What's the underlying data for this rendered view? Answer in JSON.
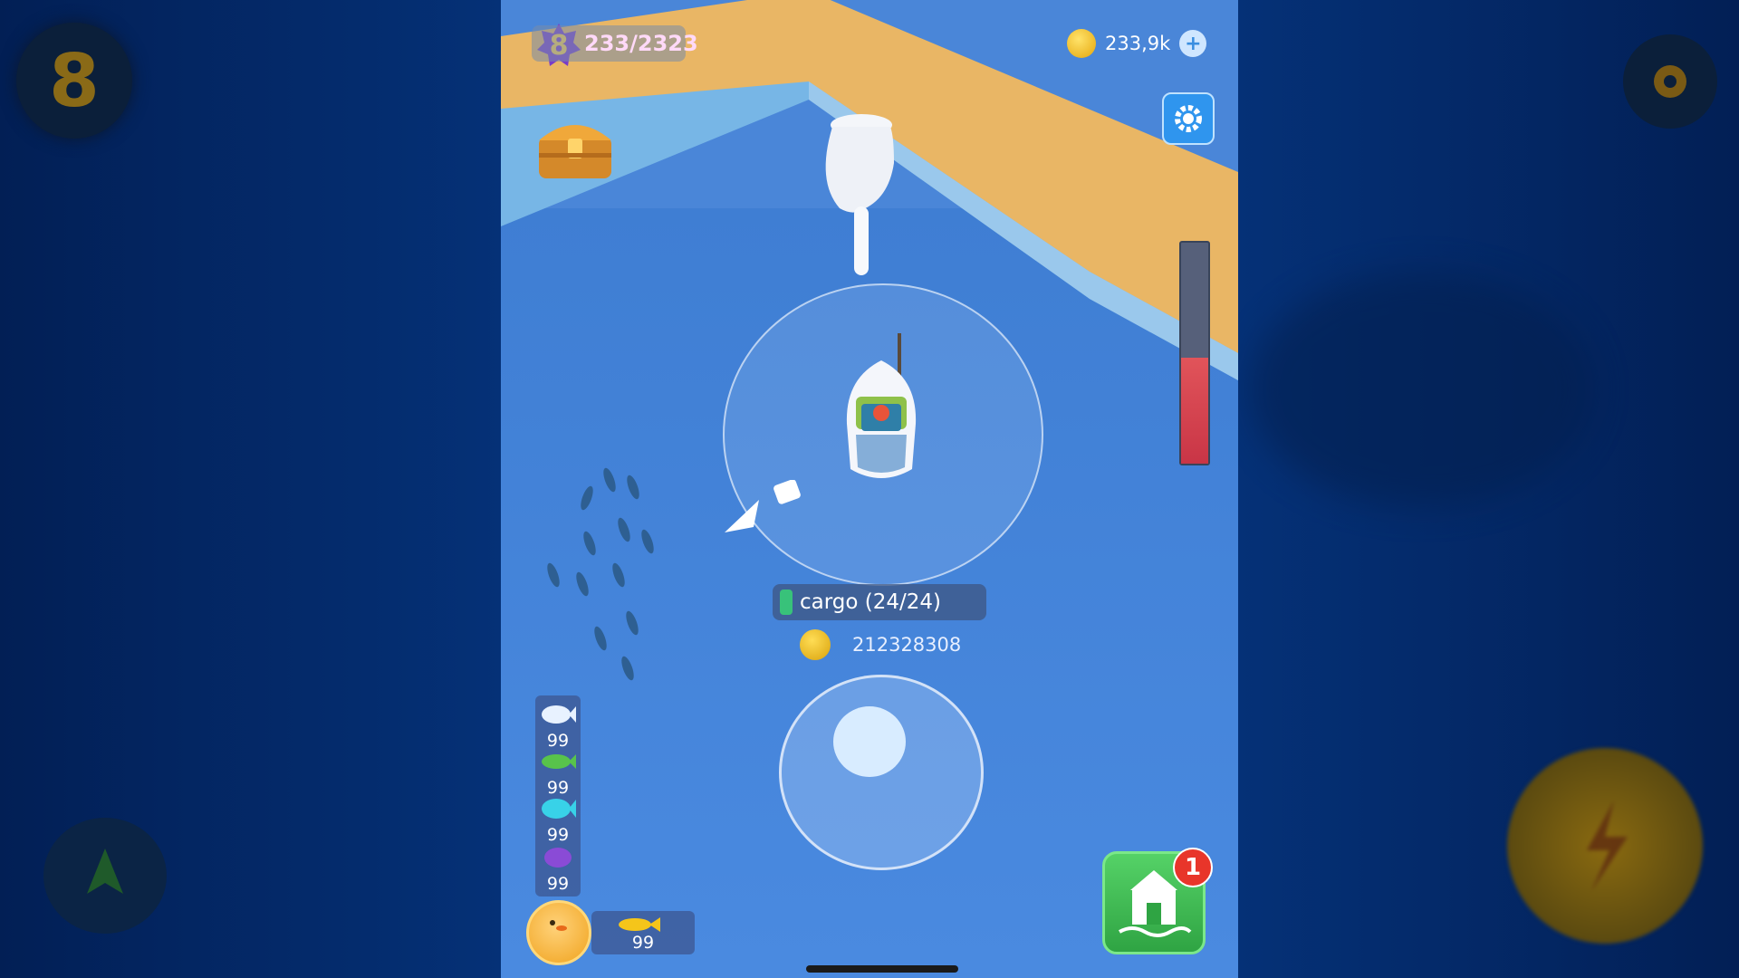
{
  "hud": {
    "level": "8",
    "xp_text": "233/2323",
    "coins": "233,9k",
    "coins_plus": "+",
    "settings_icon": "gear-icon"
  },
  "gauge": {
    "fill_fraction": 0.48
  },
  "cargo": {
    "label": "cargo (24/24)",
    "value": "212328308"
  },
  "inventory": {
    "items": [
      {
        "name": "white-fish",
        "count": "99",
        "color": "#e8f2ff"
      },
      {
        "name": "green-fish",
        "count": "99",
        "color": "#58c34b"
      },
      {
        "name": "cyan-fish",
        "count": "99",
        "color": "#38d2e8"
      },
      {
        "name": "purple-fish",
        "count": "99",
        "color": "#8a4bd6"
      }
    ],
    "pet_count": "99"
  },
  "shop": {
    "badge": "1"
  },
  "blurred_sides": {
    "level_text": "8"
  }
}
